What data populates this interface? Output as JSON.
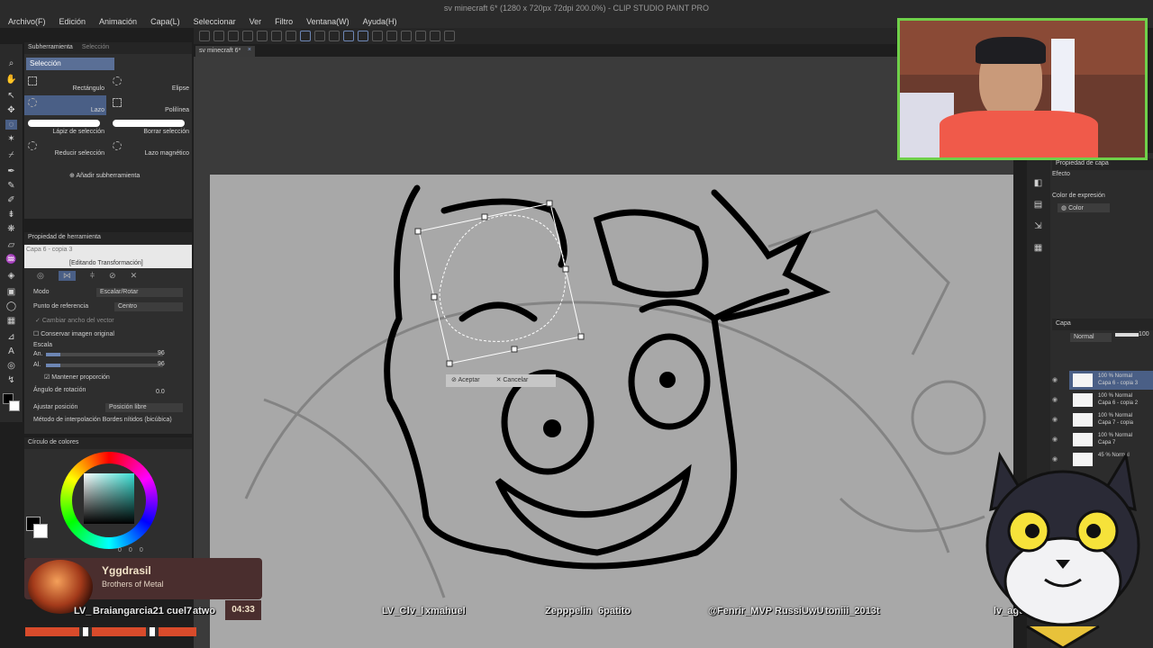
{
  "window": {
    "title": "sv minecraft 6* (1280 x 720px 72dpi 200.0%) - CLIP STUDIO PAINT PRO"
  },
  "menu": [
    "Archivo(F)",
    "Edición",
    "Animación",
    "Capa(L)",
    "Seleccionar",
    "Ver",
    "Filtro",
    "Ventana(W)",
    "Ayuda(H)"
  ],
  "document": {
    "tab_label": "sv minecraft 6*"
  },
  "subtool_panel": {
    "tab_labels": [
      "Subherramienta",
      "Selección"
    ],
    "group_label": "Selección",
    "items": [
      {
        "label": "Rectángulo",
        "selected": false
      },
      {
        "label": "Elipse",
        "selected": false
      },
      {
        "label": "Lazo",
        "selected": true
      },
      {
        "label": "Polilínea",
        "selected": false
      },
      {
        "label": "Lápiz de selección",
        "selected": false
      },
      {
        "label": "Borrar selección",
        "selected": false
      },
      {
        "label": "Reducir selección",
        "selected": false
      },
      {
        "label": "Lazo magnético",
        "selected": false
      }
    ],
    "add_label": "Añadir subherramienta"
  },
  "tool_property": {
    "tab_label": "Propiedad de herramienta",
    "layer_label": "Capa 6 - copia 3",
    "editing_label": "[Editando Transformación]",
    "mode_label": "Modo",
    "mode_value": "Escalar/Rotar",
    "ref_label": "Punto de referencia",
    "ref_value": "Centro",
    "change_width_label": "Cambiar ancho del vector",
    "keep_original_label": "Conservar imagen original",
    "scale_label": "Escala",
    "width_label": "An.",
    "width_value": "96",
    "height_label": "Al.",
    "height_value": "96",
    "keep_ratio_label": "Mantener proporción",
    "rotation_label": "Ángulo de rotación",
    "rotation_value": "0.0",
    "adjust_pos_label": "Ajustar posición",
    "adjust_pos_value": "Posición libre",
    "interp_label": "Método de interpolación",
    "interp_value": "Bordes nítidos (bicúbica)"
  },
  "color_circle": {
    "tab_label": "Círculo de colores",
    "values": [
      "0",
      "0",
      "0"
    ]
  },
  "transform_bar": {
    "accept_label": "Aceptar",
    "cancel_label": "Cancelar"
  },
  "right_panel": {
    "tab_label": "Propiedad de capa",
    "effect_label": "Efecto",
    "expression_label": "Color de expresión",
    "expression_value": "Color",
    "layer_tab_label": "Capa",
    "blend_value": "Normal",
    "opacity_value": "100",
    "layers": [
      {
        "line1": "100 % Normal",
        "line2": "Capa 6 - copia 3",
        "selected": true
      },
      {
        "line1": "100 % Normal",
        "line2": "Capa 6 - copia 2",
        "selected": false
      },
      {
        "line1": "100 % Normal",
        "line2": "Capa 7 - copia",
        "selected": false
      },
      {
        "line1": "100 % Normal",
        "line2": "Capa 7",
        "selected": false
      },
      {
        "line1": "45 % Normal",
        "line2": "",
        "selected": false
      }
    ]
  },
  "stream_overlay": {
    "alert": {
      "name": "Yggdrasil",
      "song": "Brothers of Metal",
      "time": "04:33"
    },
    "viewers": [
      "LV_",
      "Braiangarcia21",
      "cuel7",
      "atwo",
      "LV_Cl",
      "lv_l",
      "xmahuel",
      "Zepppelin",
      "6patito",
      "@",
      "Fenrir_MVP",
      "RussiUwU",
      "toniii_2013t",
      "lv_agus20xx"
    ]
  },
  "colors": {
    "accent": "#4a5f86",
    "webcam_border": "#6fd04a",
    "canvas": "#a8a8a8",
    "panel": "#2e2e2e"
  },
  "icons": [
    "zoom-icon",
    "move-icon",
    "lasso-icon",
    "pen-icon",
    "brush-icon",
    "eraser-icon",
    "fill-icon",
    "text-icon",
    "gradient-icon",
    "eyedropper-icon"
  ]
}
